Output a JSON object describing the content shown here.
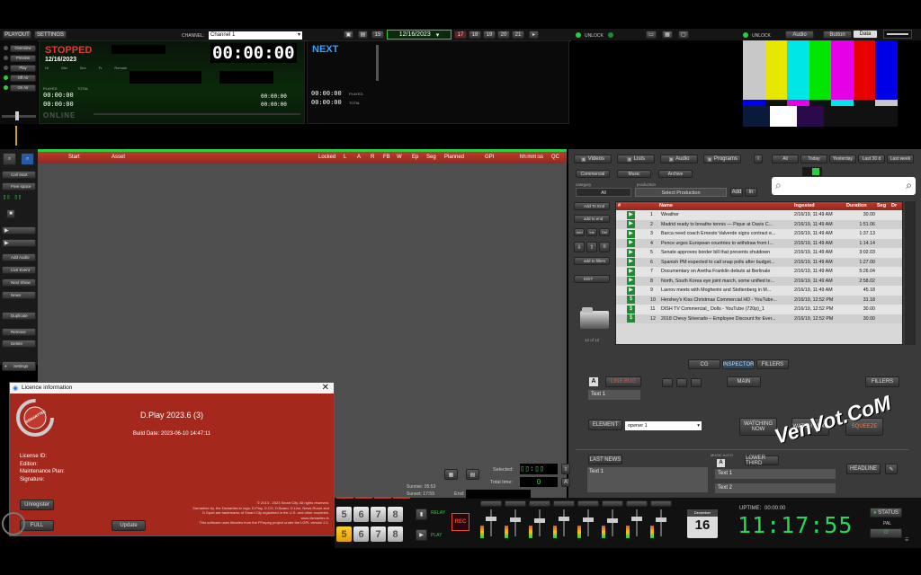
{
  "toolbar": {
    "tab_playout": "PLAYOUT",
    "tab_settings": "SETTINGS",
    "channel_label": "CHANNEL:",
    "channel_value": "Channel 1",
    "nav_prev": "15",
    "date_value": "12/16/2023",
    "nav_days": [
      "18",
      "19",
      "20",
      "21"
    ],
    "unlock_label": "UNLOCK",
    "unlock2_label": "UNLOCK",
    "btn_a": "Audio",
    "btn_b": "Button",
    "data_label": "Data"
  },
  "side_modes": [
    "Overview",
    "Preview",
    "Play",
    "Off Air",
    "On Air"
  ],
  "status": {
    "state": "STOPPED",
    "date": "12/16/2023",
    "timecode": "00:00:00",
    "onl_label": "ONLINE",
    "mini_labels": [
      "Hr",
      "Min",
      "Sec",
      "Fr",
      "Remain"
    ],
    "played_label": "PLAYED",
    "total_label": "TOTAL",
    "small_tc": [
      "00:00:00",
      "00:00:00"
    ],
    "right_tc": "00:00:00",
    "right_tc2": "00:00:00"
  },
  "next": {
    "label": "NEXT",
    "small_tc": [
      "00:00:00",
      "00:00:00"
    ],
    "played_label": "PLAYED",
    "total_label": "TOTAL"
  },
  "left_tools": {
    "call_start": "Call Start",
    "free_space": "Free space",
    "add_audio": "Add Audio",
    "live_event": "Live Event",
    "next_show": "Next Show",
    "news": "News",
    "duplicate": "Duplicate",
    "remove": "Remove",
    "delete": "Delete",
    "settings": "Settings"
  },
  "playlist": {
    "columns": [
      "Start",
      "Asset",
      "Locked",
      "L",
      "A",
      "R",
      "FB",
      "W",
      "Ep",
      "Seg",
      "Planned",
      "GPI",
      "hh:mm:ss",
      "QC"
    ]
  },
  "media": {
    "tabs": [
      "Videos",
      "Lists",
      "Audio",
      "Programs"
    ],
    "subtabs": [
      "Commercial",
      "Music",
      "Archive"
    ],
    "filter_tabs": [
      "All",
      "Today",
      "Yesterday",
      "Last 30 d",
      "Last week"
    ],
    "category_label": "category",
    "production_label": "production",
    "category_value": "All",
    "production_value": "Select Production",
    "add_label": "Add",
    "in_label": "In",
    "search_placeholder": "",
    "side_btns": [
      "Add To End",
      "add to end",
      "Add",
      "Ins",
      "Del",
      "add to fillers",
      "EDIT"
    ],
    "folder_caption": "12 of 12",
    "columns": [
      "#",
      "Name",
      "Ingested",
      "Duration",
      "Seg",
      "Dr"
    ],
    "rows": [
      {
        "num": "1",
        "name": "Weather",
        "ingested": "2/16/19, 11:49 AM",
        "dur": "30.00"
      },
      {
        "num": "2",
        "name": "Madrid ready to breathe tennis — Pique at Davis C...",
        "ingested": "2/16/19, 11:49 AM",
        "dur": "1:51.06"
      },
      {
        "num": "3",
        "name": "Barca need coach Ernesto Valverde signs contract e...",
        "ingested": "2/16/19, 11:49 AM",
        "dur": "1:37.13"
      },
      {
        "num": "4",
        "name": "Pence urges European countries to withdraw from I...",
        "ingested": "2/16/19, 11:49 AM",
        "dur": "1:14.14"
      },
      {
        "num": "5",
        "name": "Senate approves border bill that prevents shutdown",
        "ingested": "2/16/19, 11:49 AM",
        "dur": "3:02.03"
      },
      {
        "num": "6",
        "name": "Spanish PM expected to call snap polls after budget...",
        "ingested": "2/16/19, 11:49 AM",
        "dur": "1:27.00"
      },
      {
        "num": "7",
        "name": "Documentary on Aretha Franklin debuts at Berlinale",
        "ingested": "2/16/19, 11:49 AM",
        "dur": "5:26.04"
      },
      {
        "num": "8",
        "name": "North, South Korea eye joint march, some unified te...",
        "ingested": "2/16/19, 11:49 AM",
        "dur": "2:58.02"
      },
      {
        "num": "9",
        "name": "Lavrov meets with Mogherini and Stoltenberg in M...",
        "ingested": "2/16/19, 11:49 AM",
        "dur": "45.18"
      },
      {
        "num": "10",
        "name": "Hershey's Kiss Christmas Commercial HD - YouTube...",
        "ingested": "2/16/19, 12:52 PM",
        "dur": "31.18"
      },
      {
        "num": "11",
        "name": "DISH TV Commercial_ Dolls - YouTube (720p)_1",
        "ingested": "2/16/19, 12:52 PM",
        "dur": "30.00"
      },
      {
        "num": "12",
        "name": "2018 Chevy Silverado – Employee Discount for Ever...",
        "ingested": "2/16/19, 12:52 PM",
        "dur": "30.00"
      }
    ],
    "bottom_tabs": [
      "CG",
      "INSPECTOR",
      "FILLERS"
    ]
  },
  "cg": {
    "a_label": "A",
    "line_btn": "LINE BUG",
    "text1_value": "Text 1",
    "main_btn": "MAIN",
    "fillers_btn": "FILLERS",
    "element_btn": "ELEMENT",
    "element_value": "opener 1",
    "watching_btn": "WATCHING NOW",
    "watch_next_btn": "WATCH NEXT",
    "squeeze_btn": "SQUEEZE",
    "last_news_btn": "LAST NEWS",
    "last_news_text": "Text 1",
    "music_auto_label": "MUSIC AUTO",
    "music_a_label": "A",
    "music_btn": "LOWER THIRD",
    "music_text1": "Text 1",
    "music_text2": "Text 2",
    "headline_btn": "HEADLINE"
  },
  "bottom": {
    "sunrise_label": "Sunrise:",
    "sunrise_value": "05:53",
    "sunset_label": "Sunset:",
    "sunset_value": "17:59",
    "selected_label": "Selected:",
    "total_time_label": "Total time:",
    "total_time_value": "0",
    "end_label": "End:",
    "num_keys_top": [
      "5",
      "6",
      "7",
      "8"
    ],
    "num_keys_bottom": [
      "5",
      "6",
      "7",
      "8"
    ],
    "cg_a": "RELAY",
    "cg_b": "PLAY",
    "rec_label": "REC",
    "calendar_month": "December",
    "calendar_day": "16",
    "uptime_label": "UPTIME:",
    "uptime_value": "00:00:00",
    "clock": "11:17:55",
    "status_label": "STATUS",
    "pal_label": "PAL",
    "watermark": "VenVot.CoM"
  },
  "dialog": {
    "title": "Licence information",
    "product": "D.Play 2023.6 (3)",
    "build": "Build Date: 2023-06-10 14:47:11",
    "fields": [
      "License ID:",
      "Edition:",
      "Maintenance Plan:",
      "Signature:"
    ],
    "unregister_btn": "Unregister",
    "full_btn": "FULL",
    "update_btn": "Update",
    "legal_1": "© 2013 - 2023 Smart City. All rights reserved.",
    "legal_2": "Dsmarttec by, the Dsmarttec.tv logo, D.Play, D.CG, D.Board, D.Live, News Room and",
    "legal_3": "D.Sport are trademarks of Smart City registered in the U.S. and other countries.",
    "legal_4": "www.dsmarttec.tv",
    "legal_5": "This software uses libraries from the FFmpeg project under the LGPL version 2.1.",
    "logo_text": "DSMARTTEC"
  },
  "colors": {
    "accent_red": "#c0392b",
    "green_led": "#2ecc40",
    "next_blue": "#3aa0ff"
  }
}
